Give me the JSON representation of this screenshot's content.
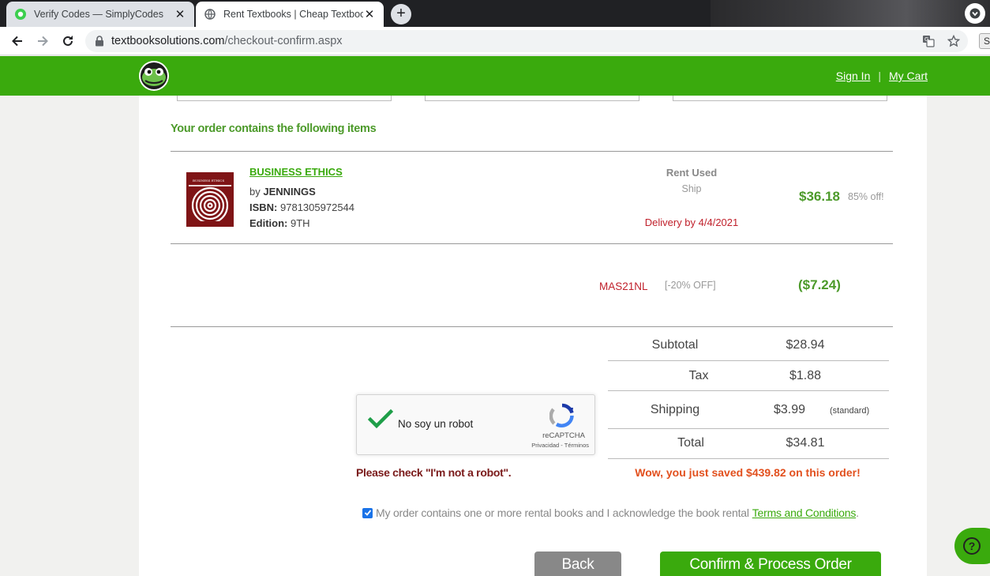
{
  "browser": {
    "tabs": [
      {
        "title": "Verify Codes — SimplyCodes",
        "active": false
      },
      {
        "title": "Rent Textbooks | Cheap Textboo",
        "active": true
      }
    ],
    "url_domain": "textbooksolutions.com",
    "url_path": "/checkout-confirm.aspx",
    "extension_label": "S"
  },
  "header": {
    "sign_in": "Sign In",
    "separator": "|",
    "my_cart": "My Cart",
    "brand_color": "#3aaa0d"
  },
  "order": {
    "heading": "Your order contains the following items",
    "item": {
      "title": "BUSINESS ETHICS",
      "author_prefix": "by",
      "author": "JENNINGS",
      "isbn_label": "ISBN:",
      "isbn": "9781305972544",
      "edition_label": "Edition:",
      "edition": "9TH",
      "rental_type": "Rent Used",
      "shipping_method": "Ship",
      "delivery": "Delivery by 4/4/2021",
      "price": "$36.18",
      "discount": "85% off!"
    },
    "coupon": {
      "code": "MAS21NL",
      "off": "[-20% OFF]",
      "amount": "($7.24)"
    }
  },
  "totals": {
    "subtotal_label": "Subtotal",
    "subtotal": "$28.94",
    "tax_label": "Tax",
    "tax": "$1.88",
    "shipping_label": "Shipping",
    "shipping": "$3.99",
    "shipping_note": "(standard)",
    "total_label": "Total",
    "total": "$34.81"
  },
  "recaptcha": {
    "label": "No soy un robot",
    "brand": "reCAPTCHA",
    "links": "Privacidad - Términos",
    "checked": true
  },
  "messages": {
    "robot": "Please check \"I'm not a robot\".",
    "saved": "Wow, you just saved $439.82 on this order!"
  },
  "acknowledge": {
    "text": "My order contains one or more rental books and I acknowledge the book rental",
    "link": "Terms and Conditions",
    "suffix": ".",
    "checked": true
  },
  "buttons": {
    "back": "Back",
    "confirm": "Confirm & Process Order"
  },
  "icons": [
    "simplycodes-icon",
    "globe-icon",
    "close-icon",
    "plus-icon",
    "profile-icon",
    "back-arrow-icon",
    "forward-arrow-icon",
    "reload-icon",
    "lock-icon",
    "translate-icon",
    "star-icon",
    "frog-logo-icon",
    "checkmark-icon",
    "recaptcha-icon",
    "help-icon"
  ]
}
